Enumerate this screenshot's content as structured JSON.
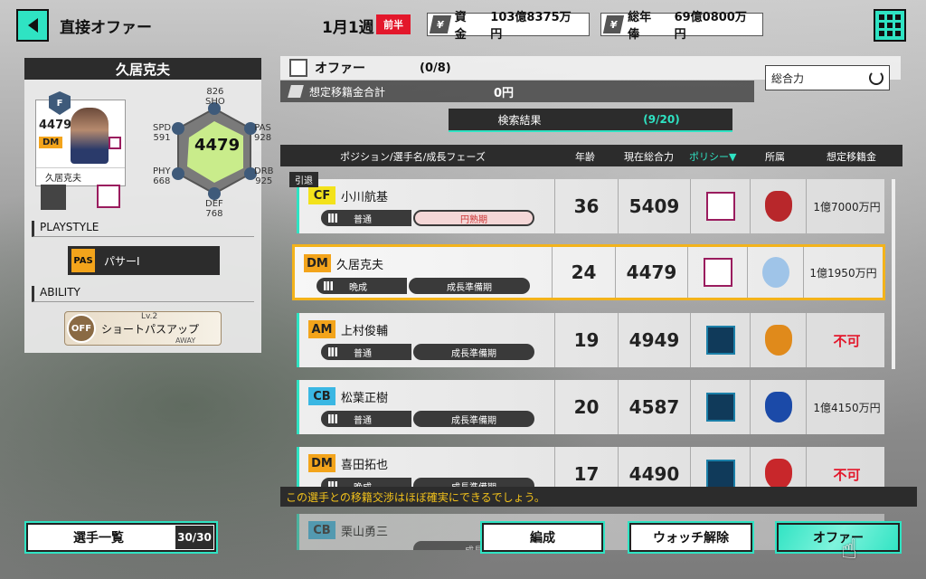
{
  "header": {
    "title": "直接オファー",
    "week": "1月1週",
    "half": "前半",
    "funds_label": "資金",
    "funds_value": "103億8375万円",
    "salary_label": "総年俸",
    "salary_value": "69億0800万円"
  },
  "player": {
    "name": "久居克夫",
    "card_ovr": "4479",
    "card_pos": "DM",
    "card_name": "久居克夫",
    "total": "4479",
    "stats": {
      "sho_label": "SHO",
      "sho": "826",
      "pas_label": "PAS",
      "pas": "928",
      "drb_label": "DRB",
      "drb": "925",
      "def_label": "DEF",
      "def": "768",
      "phy_label": "PHY",
      "phy": "668",
      "spd_label": "SPD",
      "spd": "591"
    },
    "playstyle_label": "PLAYSTYLE",
    "playstyle": "パサーⅠ",
    "playstyle_icon": "PAS",
    "ability_label": "ABILITY",
    "ability": "ショートパスアップ",
    "ability_icon": "OFF",
    "ability_lv": "Lv.2",
    "ability_tag": "AWAY"
  },
  "offer": {
    "title": "オファー",
    "count": "(0/8)",
    "fee_label": "想定移籍金合計",
    "fee_value": "0円",
    "sort": "総合力",
    "tab_results": "検索結果",
    "tab_count": "(9/20)"
  },
  "columns": {
    "name": "ポジション/選手名/成長フェーズ",
    "age": "年齢",
    "ovr": "現在総合力",
    "policy": "ポリシー▼",
    "club": "所属",
    "fee": "想定移籍金"
  },
  "retire_tag": "引退",
  "rows": [
    {
      "pos": "CF",
      "pos_color": "#f3e21b",
      "name": "小川航基",
      "type": "普通",
      "phase": "円熟期",
      "age": "36",
      "ovr": "5409",
      "fee": "1億7000万円"
    },
    {
      "pos": "DM",
      "pos_color": "#f3a41b",
      "name": "久居克夫",
      "type": "晩成",
      "phase": "成長準備期",
      "age": "24",
      "ovr": "4479",
      "fee": "1億1950万円"
    },
    {
      "pos": "AM",
      "pos_color": "#f3a41b",
      "name": "上村俊輔",
      "type": "普通",
      "phase": "成長準備期",
      "age": "19",
      "ovr": "4949",
      "fee": "不可"
    },
    {
      "pos": "CB",
      "pos_color": "#3ab7e3",
      "name": "松葉正樹",
      "type": "普通",
      "phase": "成長準備期",
      "age": "20",
      "ovr": "4587",
      "fee": "1億4150万円"
    },
    {
      "pos": "DM",
      "pos_color": "#f3a41b",
      "name": "喜田拓也",
      "type": "晩成",
      "phase": "成長準備期",
      "age": "17",
      "ovr": "4490",
      "fee": "不可"
    },
    {
      "pos": "CB",
      "pos_color": "#3ab7e3",
      "name": "栗山勇三",
      "type": "",
      "phase": "成長",
      "age": "",
      "ovr": "",
      "fee": ""
    }
  ],
  "notice": "この選手との移籍交渉はほぼ確実にできるでしょう。",
  "buttons": {
    "player_list": "選手一覧",
    "player_count": "30/30",
    "formation": "編成",
    "unwatch": "ウォッチ解除",
    "offer": "オファー"
  }
}
